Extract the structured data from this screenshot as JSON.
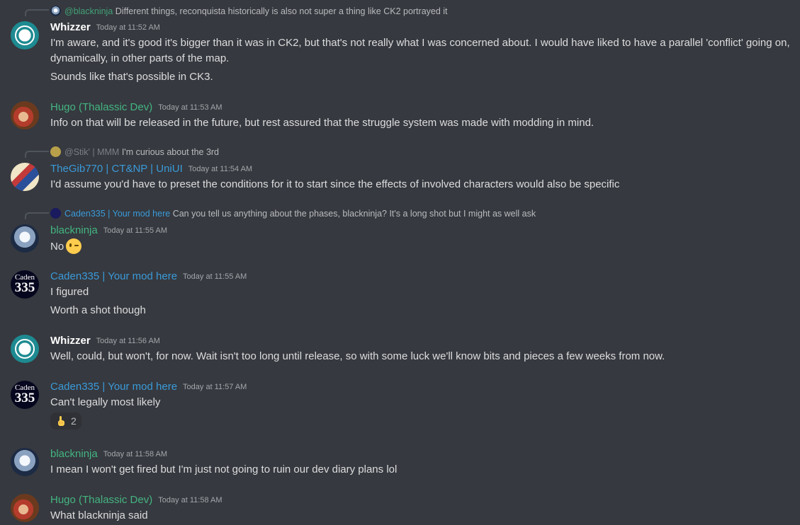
{
  "messages": [
    {
      "reply": {
        "name": "@blackninja",
        "text": "Different things, reconquista historically is also not super a thing like CK2 portrayed it"
      },
      "author": "Whizzer",
      "time": "Today at 11:52 AM",
      "lines": [
        "I'm aware, and it's good it's bigger than it was in CK2, but that's not really what I was concerned about. I would have liked to have a parallel 'conflict' going on,",
        "dynamically, in other parts of the map.",
        "Sounds like that's possible in CK3."
      ]
    },
    {
      "author": "Hugo (Thalassic Dev)",
      "time": "Today at 11:53 AM",
      "lines": [
        "Info on that will be released in the future, but rest assured that the struggle system was made with modding in mind."
      ]
    },
    {
      "reply": {
        "name": "@Stik' | MMM",
        "text": "I'm curious about the 3rd"
      },
      "author": "TheGib770 | CT&NP | UniUI",
      "time": "Today at 11:54 AM",
      "lines": [
        "I'd assume you'd have to preset the conditions for it to start since the effects of involved characters would also be specific"
      ]
    },
    {
      "reply": {
        "name": "Caden335 | Your mod here",
        "text": "Can you tell us anything about the phases, blackninja? It's a long shot but I might as well ask"
      },
      "author": "blackninja",
      "time": "Today at 11:55 AM",
      "lines": [
        "No"
      ]
    },
    {
      "author": "Caden335 | Your mod here",
      "time": "Today at 11:55 AM",
      "lines": [
        "I figured",
        "Worth a shot though"
      ]
    },
    {
      "author": "Whizzer",
      "time": "Today at 11:56 AM",
      "lines": [
        "Well, could, but won't, for now. Wait isn't too long until release, so with some luck we'll know bits and pieces a few weeks from now."
      ]
    },
    {
      "author": "Caden335 | Your mod here",
      "time": "Today at 11:57 AM",
      "lines": [
        "Can't legally most likely"
      ],
      "reaction": {
        "emoji": "point-up-hand",
        "count": "2"
      }
    },
    {
      "author": "blackninja",
      "time": "Today at 11:58 AM",
      "lines": [
        "I mean I won't get fired but I'm just not going to ruin our dev diary plans lol"
      ]
    },
    {
      "author": "Hugo (Thalassic Dev)",
      "time": "Today at 11:58 AM",
      "lines": [
        "What blackninja said"
      ]
    }
  ],
  "avatar_text": {
    "caden_top": "Caden",
    "caden_bottom": "335"
  }
}
